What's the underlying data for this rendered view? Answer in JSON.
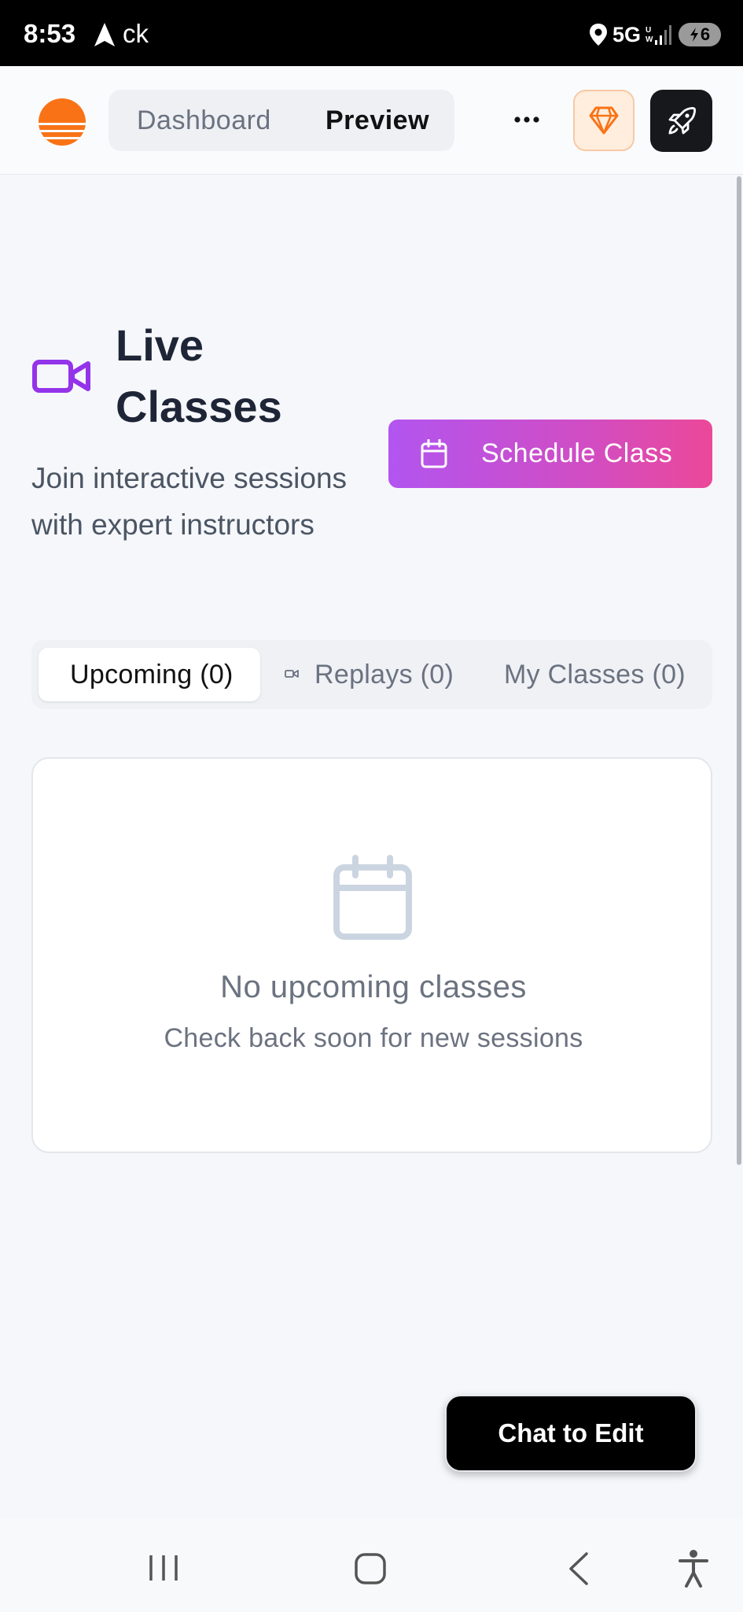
{
  "status_bar": {
    "time": "8:53",
    "app_text": "ck",
    "network": "5G",
    "battery": "6"
  },
  "header": {
    "logo": "sun-logo-icon",
    "segments": [
      {
        "label": "Dashboard",
        "active": false
      },
      {
        "label": "Preview",
        "active": true
      }
    ],
    "more_icon": "more-horizontal-icon",
    "gem_icon": "gem-icon",
    "rocket_icon": "rocket-icon",
    "accent_orange": "#f97316"
  },
  "hero": {
    "icon": "video-camera-icon",
    "title": "Live Classes",
    "subtitle": "Join interactive sessions with expert instructors",
    "schedule_button": "Schedule Class",
    "brand_purple": "#9333ea",
    "gradient": [
      "#b255f0",
      "#ec4899"
    ]
  },
  "tabs": [
    {
      "label": "Upcoming (0)",
      "active": true
    },
    {
      "label": "Replays (0)",
      "active": false,
      "icon": "video-camera-icon"
    },
    {
      "label": "My Classes (0)",
      "active": false
    }
  ],
  "empty_state": {
    "icon": "calendar-icon",
    "title": "No upcoming classes",
    "subtitle": "Check back soon for new sessions"
  },
  "chat_button": "Chat to Edit",
  "bottom_nav": [
    "recents-icon",
    "home-icon",
    "back-icon",
    "accessibility-icon"
  ]
}
